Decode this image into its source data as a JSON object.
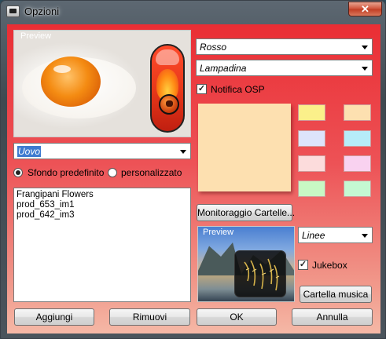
{
  "window": {
    "title": "Opzioni",
    "close_label": "✕"
  },
  "preview1": {
    "label": "Preview"
  },
  "theme_combo": {
    "value": "Uovo"
  },
  "background": {
    "default_label": "Sfondo predefinito",
    "custom_label": "personalizzato",
    "selected": "default"
  },
  "file_list": {
    "items": [
      "Frangipani Flowers",
      "prod_653_im1",
      "prod_642_im3"
    ]
  },
  "color_combo": {
    "value": "Rosso"
  },
  "icon_combo": {
    "value": "Lampadina"
  },
  "osd": {
    "label": "Notifica OSP",
    "checked": true
  },
  "note": {
    "color": "#fde0b0"
  },
  "swatches": {
    "colors": [
      "#fbf08a",
      "#fde0b0",
      "#dde4fb",
      "#b6ecf8",
      "#fcdcdc",
      "#f9d2f0",
      "#c8f8c4",
      "#c4f8d2"
    ]
  },
  "monitor_button": {
    "label": "Monitoraggio Cartelle..."
  },
  "preview2": {
    "label": "Preview"
  },
  "lines_combo": {
    "value": "Linee"
  },
  "jukebox": {
    "label": "Jukebox",
    "checked": true
  },
  "music_folder_button": {
    "label": "Cartella musica"
  },
  "footer": {
    "add_label": "Aggiungi",
    "remove_label": "Rimuovi",
    "ok_label": "OK",
    "cancel_label": "Annulla"
  },
  "colors": {
    "accent_red": "#ea2e34",
    "selection_blue": "#3d7bd0"
  }
}
